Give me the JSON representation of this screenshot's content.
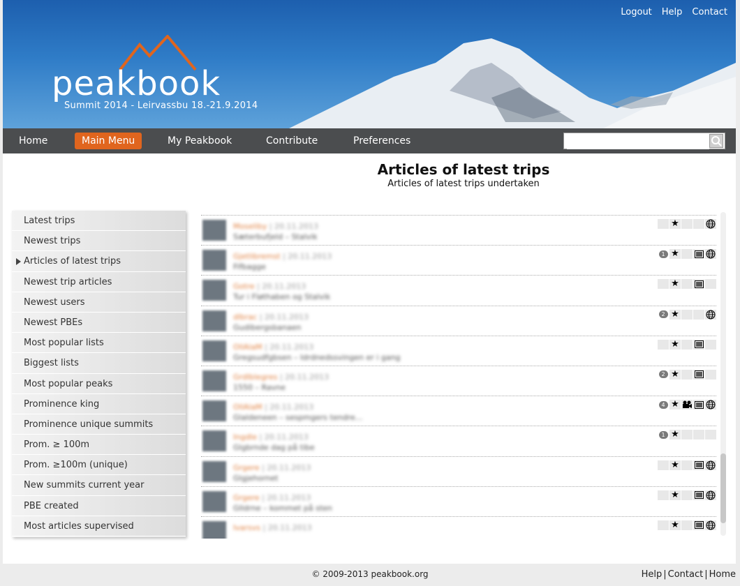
{
  "header": {
    "brand": "peakbook",
    "subtitle": "Summit 2014 - Leirvassbu 18.-21.9.2014",
    "links": [
      "Logout",
      "Help",
      "Contact"
    ]
  },
  "nav": {
    "items": [
      "Home",
      "Main Menu",
      "My Peakbook",
      "Contribute",
      "Preferences"
    ],
    "active": "Main Menu",
    "search_value": ""
  },
  "page": {
    "title": "Articles of latest trips",
    "subtitle": "Articles of latest trips undertaken"
  },
  "sidebar": {
    "items": [
      "Latest trips",
      "Newest trips",
      "Articles of latest trips",
      "Newest trip articles",
      "Newest users",
      "Newest PBEs",
      "Most popular lists",
      "Biggest lists",
      "Most popular peaks",
      "Prominence king",
      "Prominence unique summits",
      "Prom. ≥ 100m",
      "Prom. ≥100m (unique)",
      "New summits current year",
      "PBE created",
      "Most articles supervised"
    ],
    "active_index": 2
  },
  "list": {
    "rows": [
      {
        "name": "Moseliby",
        "date": "20.11.2013",
        "desc": "Sæterbufjeld – Stalvik",
        "count": "",
        "star": true,
        "image": false,
        "video": false,
        "globe": true
      },
      {
        "name": "Gjetlibremst",
        "date": "20.11.2013",
        "desc": "Fifbagge",
        "count": "1",
        "star": true,
        "image": true,
        "video": false,
        "globe": true
      },
      {
        "name": "Gotre",
        "date": "20.11.2013",
        "desc": "Tur i Fløthaben og Stalvik",
        "count": "",
        "star": true,
        "image": true,
        "video": false,
        "globe": false
      },
      {
        "name": "dlbrac",
        "date": "20.11.2013",
        "desc": "Gudibergsbanaen",
        "count": "2",
        "star": true,
        "image": false,
        "video": false,
        "globe": true
      },
      {
        "name": "OllAlaM",
        "date": "20.11.2013",
        "desc": "Gregsudfgbsen – Idrdnedssvingen er i gang",
        "count": "",
        "star": true,
        "image": true,
        "video": false,
        "globe": false
      },
      {
        "name": "Grdlblegres",
        "date": "20.11.2013",
        "desc": "1550 – Ravne",
        "count": "2",
        "star": true,
        "image": true,
        "video": false,
        "globe": false
      },
      {
        "name": "OllAlaM",
        "date": "20.11.2013",
        "desc": "Glaldeneen – sespmgers tendre…",
        "count": "4",
        "star": true,
        "image": true,
        "video": true,
        "globe": true
      },
      {
        "name": "Ingdle",
        "date": "20.11.2013",
        "desc": "Glgbrnde dag på tibe",
        "count": "1",
        "star": true,
        "image": false,
        "video": false,
        "globe": false
      },
      {
        "name": "Grgere",
        "date": "20.11.2013",
        "desc": "Glgjehornet",
        "count": "",
        "star": true,
        "image": true,
        "video": false,
        "globe": true
      },
      {
        "name": "Grgere",
        "date": "20.11.2013",
        "desc": "Glldrne – kommet på sten",
        "count": "",
        "star": true,
        "image": true,
        "video": false,
        "globe": true
      },
      {
        "name": "Ivarsvs",
        "date": "20.11.2013",
        "desc": "",
        "count": "",
        "star": true,
        "image": true,
        "video": false,
        "globe": true
      }
    ],
    "date_sep": " | "
  },
  "footer": {
    "copyright": "© 2009-2013 peakbook.org",
    "links": [
      "Help",
      "Contact",
      "Home"
    ]
  },
  "colors": {
    "accent": "#e0651e",
    "nav_bg": "#4b4d4f",
    "sky": "#2f7cc7"
  }
}
